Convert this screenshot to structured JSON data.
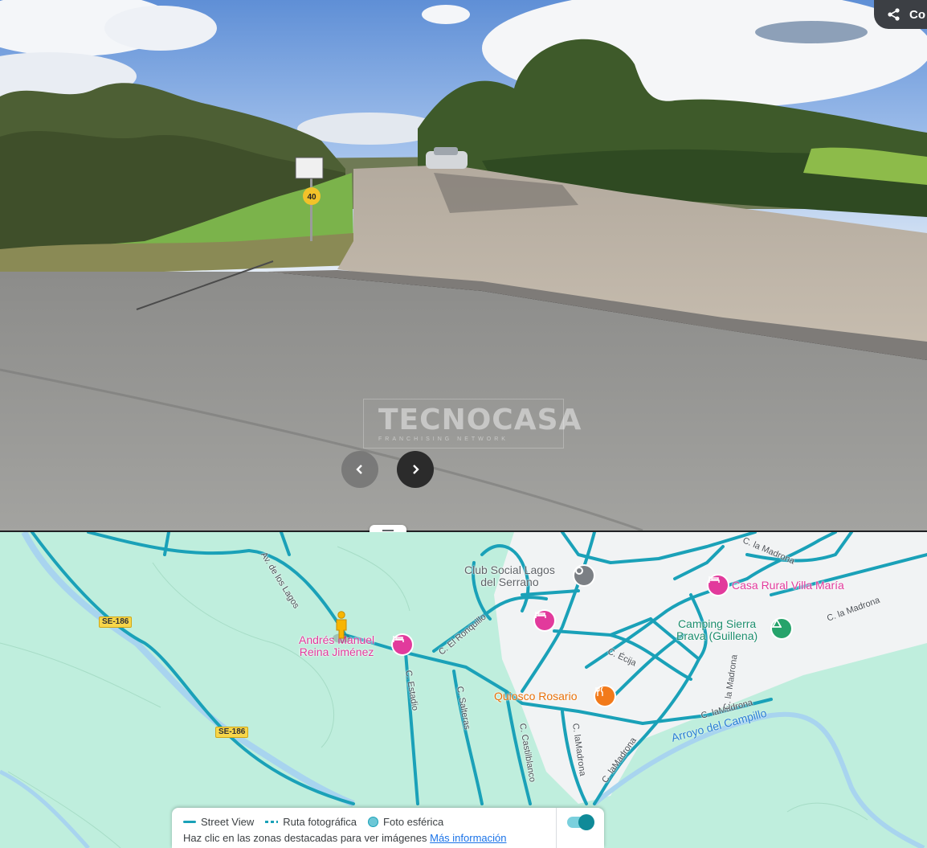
{
  "street_view": {
    "share_label": "Co",
    "sign_speed": "40",
    "watermark": {
      "brand": "TECNOCASA",
      "sub": "FRANCHISING NETWORK"
    }
  },
  "map": {
    "pois": {
      "club": {
        "line1": "Club Social Lagos",
        "line2": "del Serrano"
      },
      "casa_rural": "Casa Rural Villa María",
      "camping": {
        "line1": "Camping Sierra",
        "line2": "Brava (Guillena)"
      },
      "andres": {
        "line1": "Andrés Manuel",
        "line2": "Reina Jiménez"
      },
      "quiosco": "Quiosco Rosario"
    },
    "streets": {
      "av_lagos": "Av. de los Lagos",
      "madrona_top": "C. la Madrona",
      "madrona_right": "C. la Madrona",
      "ronquillo": "C. El Ronquillo",
      "ecija": "C. Écija",
      "estadio": "C. Estadio",
      "salteras": "C. Salteras",
      "castilblanco": "C. Castilblanco",
      "lamadrona_low": "C. laMadrona",
      "lamadrona_vert": "C. laMadrona",
      "madrona_diag": "C. laMadrona",
      "madrona_mid": "C. la Madrona"
    },
    "water": "Arroyo del Campillo",
    "roads": {
      "se186_a": "SE-186",
      "se186_b": "SE-186"
    }
  },
  "legend": {
    "street_view": "Street View",
    "photo_route": "Ruta fotográfica",
    "sphere": "Foto esférica",
    "hint": "Haz clic en las zonas destacadas para ver imágenes",
    "more": "Más información"
  },
  "colors": {
    "coverage": "#1aa1b8",
    "map_bg": "#bfeedd",
    "urban": "#f1f3f4",
    "poi_pink": "#e23a9c"
  }
}
